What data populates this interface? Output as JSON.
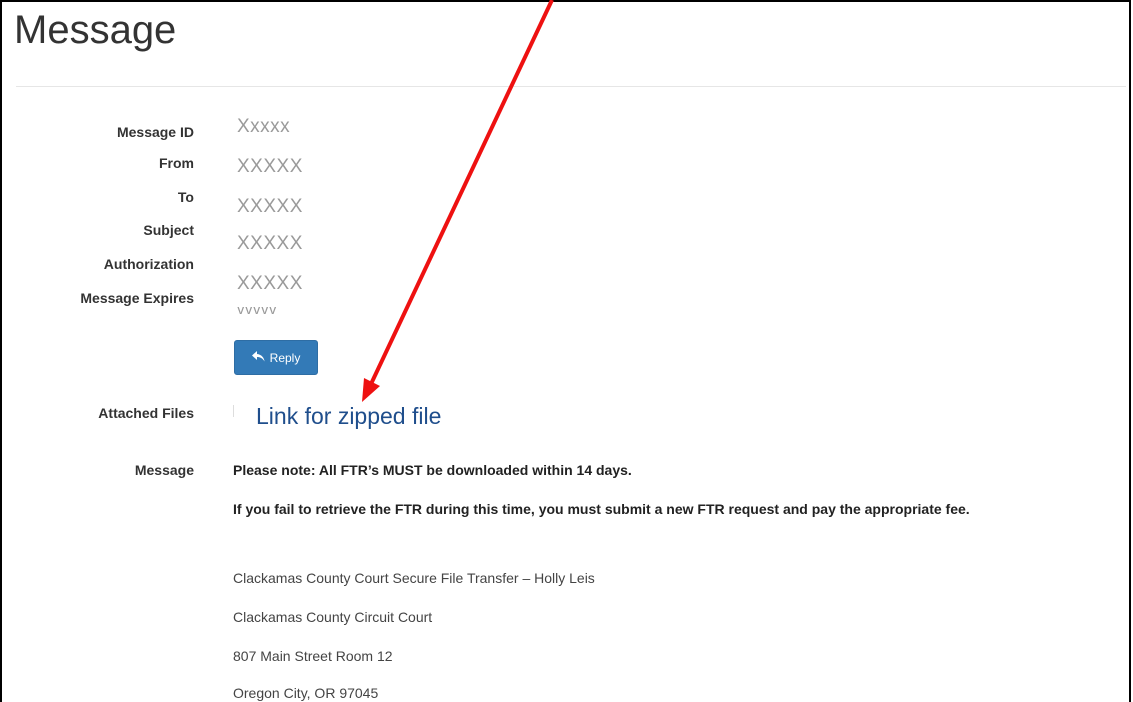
{
  "page": {
    "title": "Message"
  },
  "fields": [
    {
      "label": "Message ID",
      "value": "Xxxxx"
    },
    {
      "label": "From",
      "value": "XXXXX"
    },
    {
      "label": "To",
      "value": "XXXXX"
    },
    {
      "label": "Subject",
      "value": "XXXXX"
    },
    {
      "label": "Authorization",
      "value": "XXXXX"
    },
    {
      "label": "Message Expires",
      "value": "vvvvv"
    }
  ],
  "reply": {
    "label": "Reply",
    "icon": "reply-icon"
  },
  "attachments": {
    "label": "Attached Files",
    "link_text": "Link for zipped file"
  },
  "message": {
    "label": "Message",
    "lines_bold": [
      "Please note: All FTR’s MUST be downloaded within 14 days.",
      "If you fail to retrieve the FTR during this time, you must submit a new FTR request and pay the appropriate fee."
    ],
    "signature": [
      "Clackamas County Court Secure File Transfer – Holly Leis",
      "Clackamas County Circuit Court",
      "807 Main Street Room 12",
      "Oregon City, OR 97045"
    ]
  },
  "colors": {
    "button": "#337ab7",
    "link": "#1f4e8c",
    "arrow": "#ee1111"
  }
}
